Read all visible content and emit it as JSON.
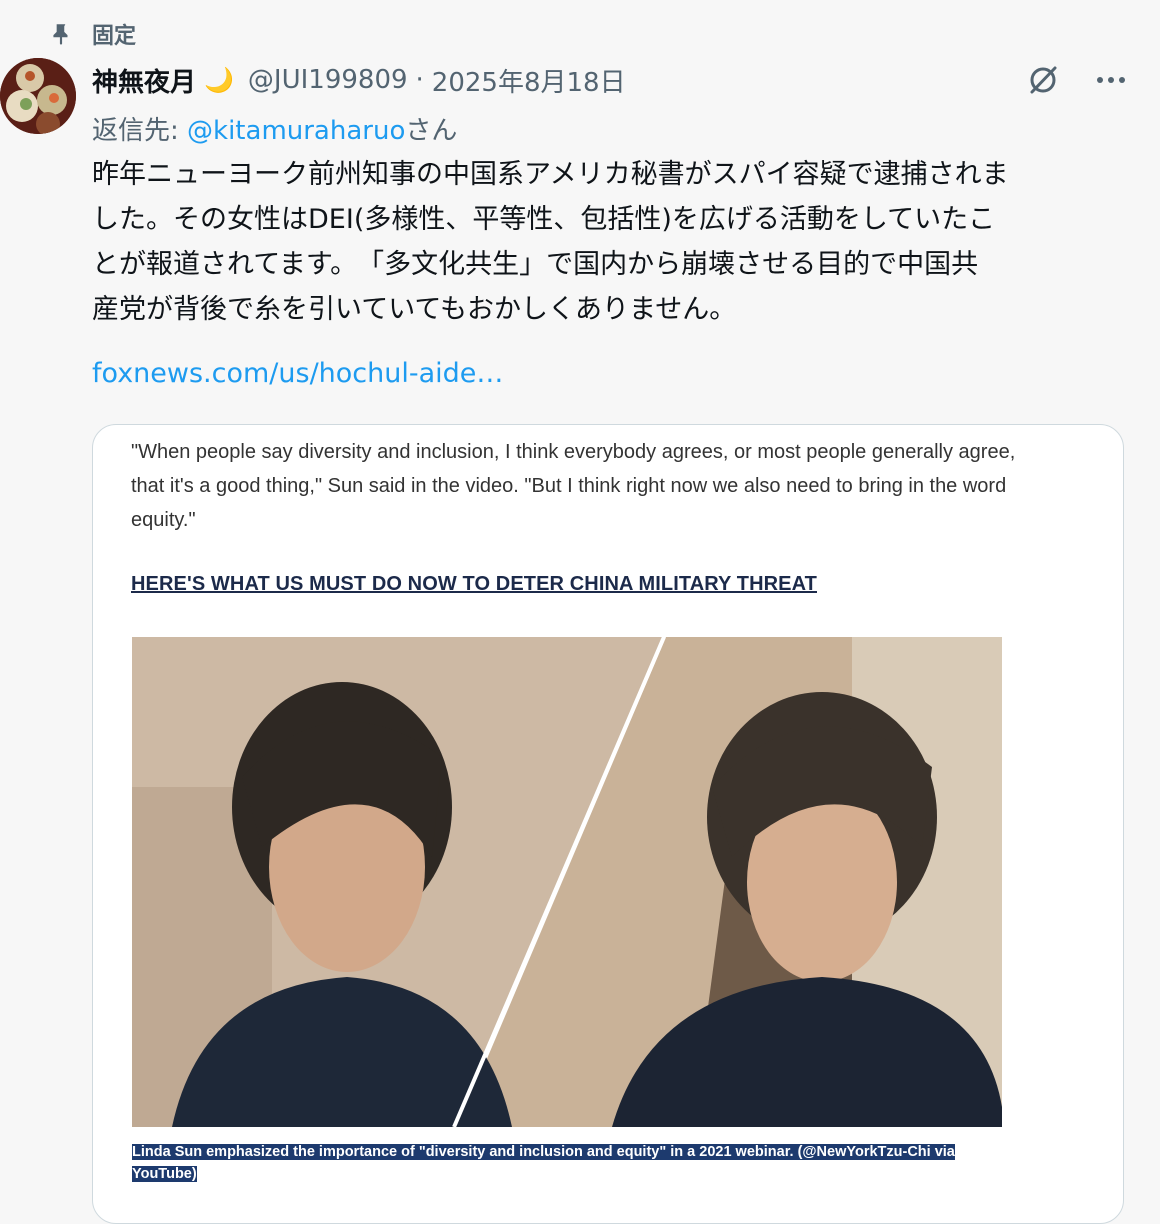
{
  "pinned_label": "固定",
  "author": {
    "display_name": "神無夜月",
    "emoji": "🌙",
    "handle": "@JUI199809",
    "separator": "·",
    "date": "2025年8月18日"
  },
  "reply": {
    "prefix": "返信先: ",
    "mention": "@kitamuraharuo",
    "suffix": "さん"
  },
  "tweet_text": "昨年ニューヨーク前州知事の中国系アメリカ秘書がスパイ容疑で逮捕されま\nした。その女性はDEI(多様性、平等性、包括性)を広げる活動をしていたこ\nとが報道されてます。　「多文化共生」で国内から崩壊させる目的で中国共\n産党が背後で糸を引いていてもおかしくありません。",
  "link_text": "foxnews.com/us/hochul-aide…",
  "card": {
    "quote": "\"When people say diversity and inclusion, I think everybody agrees, or most people generally agree, that it's a good thing,\" Sun said in the video. \"But I think right now we also need to bring in the word equity.\"",
    "headline": "HERE'S WHAT US MUST DO NOW TO DETER CHINA MILITARY THREAT",
    "caption": "Linda Sun emphasized the importance of \"diversity and inclusion and equity\" in a 2021 webinar. (@NewYorkTzu-Chi via YouTube)"
  },
  "icons": {
    "pin": "pin-icon",
    "grok": "grok-icon",
    "more": "more-options-icon",
    "moon": "crescent-moon-emoji"
  },
  "colors": {
    "link": "#1d9bf0",
    "muted": "#536471",
    "caption_bg": "#1d3a6e"
  }
}
